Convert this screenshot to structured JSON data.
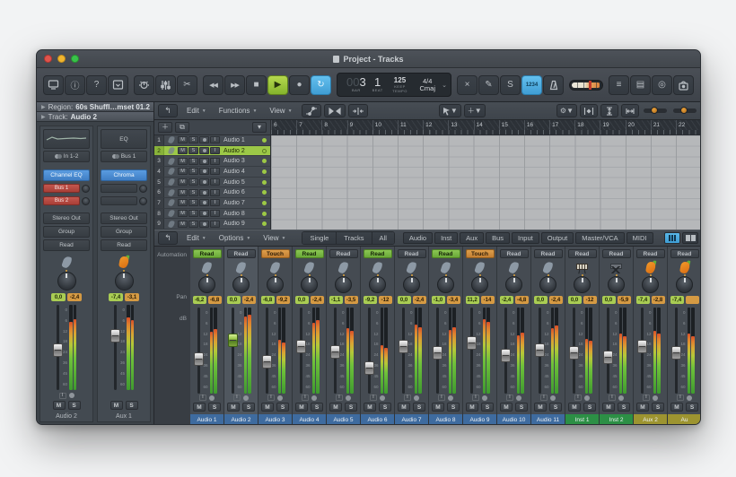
{
  "window": {
    "title": "Project - Tracks"
  },
  "lcd": {
    "bar_dim": "00",
    "bar": "3",
    "beat": "1",
    "bar_label": "BAR",
    "beat_label": "BEAT",
    "tempo": "125",
    "tempo_label_1": "KEEP",
    "tempo_label_2": "TEMPO",
    "time_sig": "4/4",
    "key": "Cmaj"
  },
  "toolbar": {
    "solo_label": "S",
    "count_in_label": "1234"
  },
  "inspector": {
    "region_label": "Region:",
    "region_value": "60s Shuffl…mset 01.2",
    "track_label": "Track:",
    "track_value": "Audio 2",
    "strips": {
      "0": {
        "input": "In 1-2",
        "plugin": "Channel EQ",
        "send1": "Bus 1",
        "send2": "Bus 2",
        "output": "Stereo Out",
        "group": "Group",
        "auto": "Read",
        "db1": "0,0",
        "db2": "-2,4",
        "name": "Audio 2",
        "fader": "45%",
        "m1": "80%",
        "m2": "83%"
      },
      "1": {
        "eq": "EQ",
        "input": "Bus 1",
        "plugin": "Chroma",
        "output": "Stereo Out",
        "group": "Group",
        "auto": "Read",
        "db1": "-7,4",
        "db2": "-3,1",
        "name": "Aux 1",
        "fader": "28%",
        "m1": "85%",
        "m2": "82%"
      }
    }
  },
  "tracks": {
    "menus": [
      {
        "label": "Edit"
      },
      {
        "label": "Functions"
      },
      {
        "label": "View"
      }
    ],
    "mute_label": "M",
    "solo_label": "S",
    "input_label": "I",
    "ruler": [
      {
        "n": "6"
      },
      {
        "n": "7"
      },
      {
        "n": "8"
      },
      {
        "n": "9"
      },
      {
        "n": "10"
      },
      {
        "n": "11"
      },
      {
        "n": "12"
      },
      {
        "n": "13"
      },
      {
        "n": "14"
      },
      {
        "n": "15"
      },
      {
        "n": "16"
      },
      {
        "n": "17"
      },
      {
        "n": "18"
      },
      {
        "n": "19"
      },
      {
        "n": "20"
      },
      {
        "n": "21"
      },
      {
        "n": "22"
      }
    ],
    "rows": [
      {
        "num": "1",
        "name": "Audio 1",
        "state": "norm"
      },
      {
        "num": "2",
        "name": "Audio 2",
        "state": "sel"
      },
      {
        "num": "3",
        "name": "Audio 3",
        "state": "norm"
      },
      {
        "num": "4",
        "name": "Audio 4",
        "state": "norm"
      },
      {
        "num": "5",
        "name": "Audio 5",
        "state": "norm"
      },
      {
        "num": "6",
        "name": "Audio 6",
        "state": "norm"
      },
      {
        "num": "7",
        "name": "Audio 7",
        "state": "norm"
      },
      {
        "num": "8",
        "name": "Audio 8",
        "state": "norm"
      },
      {
        "num": "9",
        "name": "Audio 9",
        "state": "norm"
      }
    ]
  },
  "mixer": {
    "menus": [
      {
        "label": "Edit"
      },
      {
        "label": "Options"
      },
      {
        "label": "View"
      }
    ],
    "segments": [
      {
        "label": "Single"
      },
      {
        "label": "Tracks"
      },
      {
        "label": "All"
      }
    ],
    "filters": [
      {
        "label": "Audio"
      },
      {
        "label": "Inst"
      },
      {
        "label": "Aux"
      },
      {
        "label": "Bus"
      },
      {
        "label": "Input"
      },
      {
        "label": "Output"
      },
      {
        "label": "Master/VCA"
      },
      {
        "label": "MIDI"
      }
    ],
    "labels": {
      "automation": "Automation",
      "pan": "Pan",
      "db": "dB"
    },
    "mute_label": "M",
    "solo_label": "S",
    "input_label": "I",
    "meter_scale": "0\n6\n12\n18\n24\n36\n45\n60",
    "strips": [
      {
        "name": "Audio 1",
        "tab": "blue",
        "auto": "Read",
        "astyle": "green",
        "icon": "leaf",
        "db1": "-6,2",
        "db2": "-6,8",
        "state": "norm",
        "fader": "52%",
        "m1": "72%",
        "m2": "75%"
      },
      {
        "name": "Audio 2",
        "tab": "blue",
        "auto": "Read",
        "astyle": "dark",
        "icon": "leaf",
        "db1": "0,0",
        "db2": "-2,4",
        "state": "sel",
        "fader": "30%",
        "m1": "90%",
        "m2": "92%"
      },
      {
        "name": "Audio 3",
        "tab": "blue",
        "auto": "Touch",
        "astyle": "orange",
        "icon": "leaf",
        "db1": "-6,8",
        "db2": "-9,2",
        "state": "norm",
        "fader": "55%",
        "m1": "62%",
        "m2": "59%"
      },
      {
        "name": "Audio 4",
        "tab": "blue",
        "auto": "Read",
        "astyle": "green",
        "icon": "leaf",
        "db1": "0,0",
        "db2": "-2,4",
        "state": "norm",
        "fader": "38%",
        "m1": "82%",
        "m2": "85%"
      },
      {
        "name": "Audio 5",
        "tab": "blue",
        "auto": "Read",
        "astyle": "dark",
        "icon": "leaf",
        "db1": "-1,1",
        "db2": "-3,5",
        "state": "norm",
        "fader": "44%",
        "m1": "76%",
        "m2": "73%"
      },
      {
        "name": "Audio 6",
        "tab": "blue",
        "auto": "Read",
        "astyle": "green",
        "icon": "leaf",
        "db1": "-9,2",
        "db2": "-12",
        "state": "norm",
        "fader": "62%",
        "m1": "56%",
        "m2": "53%"
      },
      {
        "name": "Audio 7",
        "tab": "blue",
        "auto": "Read",
        "astyle": "dark",
        "icon": "leaf",
        "db1": "0,0",
        "db2": "-2,4",
        "state": "norm",
        "fader": "38%",
        "m1": "80%",
        "m2": "77%"
      },
      {
        "name": "Audio 8",
        "tab": "blue",
        "auto": "Read",
        "astyle": "green",
        "icon": "leaf",
        "db1": "-1,0",
        "db2": "-3,4",
        "state": "norm",
        "fader": "45%",
        "m1": "74%",
        "m2": "77%"
      },
      {
        "name": "Audio 9",
        "tab": "blue",
        "auto": "Touch",
        "astyle": "orange",
        "icon": "leaf",
        "db1": "11,2",
        "db2": "-14",
        "state": "norm",
        "fader": "33%",
        "m1": "86%",
        "m2": "83%"
      },
      {
        "name": "Audio 10",
        "tab": "blue",
        "auto": "Read",
        "astyle": "dark",
        "icon": "leaf",
        "db1": "-2,4",
        "db2": "-4,8",
        "state": "norm",
        "fader": "48%",
        "m1": "68%",
        "m2": "71%"
      },
      {
        "name": "Audio 11",
        "tab": "blue",
        "auto": "Read",
        "astyle": "dark",
        "icon": "leaf",
        "db1": "0,0",
        "db2": "-2,4",
        "state": "norm",
        "fader": "42%",
        "m1": "76%",
        "m2": "79%"
      },
      {
        "name": "Inst 1",
        "tab": "green",
        "auto": "Read",
        "astyle": "dark",
        "icon": "keys",
        "db1": "0,0",
        "db2": "-12",
        "state": "norm",
        "fader": "45%",
        "m1": "64%",
        "m2": "61%"
      },
      {
        "name": "Inst 2",
        "tab": "green",
        "auto": "Read",
        "astyle": "dark",
        "icon": "stand",
        "db1": "0,0",
        "db2": "-5,9",
        "state": "norm",
        "fader": "50%",
        "m1": "70%",
        "m2": "67%"
      },
      {
        "name": "Aux 2",
        "tab": "olive",
        "auto": "Read",
        "astyle": "dark",
        "icon": "fruit",
        "db1": "-7,4",
        "db2": "-2,8",
        "state": "norm",
        "fader": "38%",
        "m1": "73%",
        "m2": "70%"
      },
      {
        "name": "Au",
        "tab": "olive",
        "auto": "Read",
        "astyle": "dark",
        "icon": "fruit",
        "db1": "-7,4",
        "db2": "",
        "state": "norm",
        "fader": "45%",
        "m1": "70%",
        "m2": "67%"
      }
    ]
  }
}
